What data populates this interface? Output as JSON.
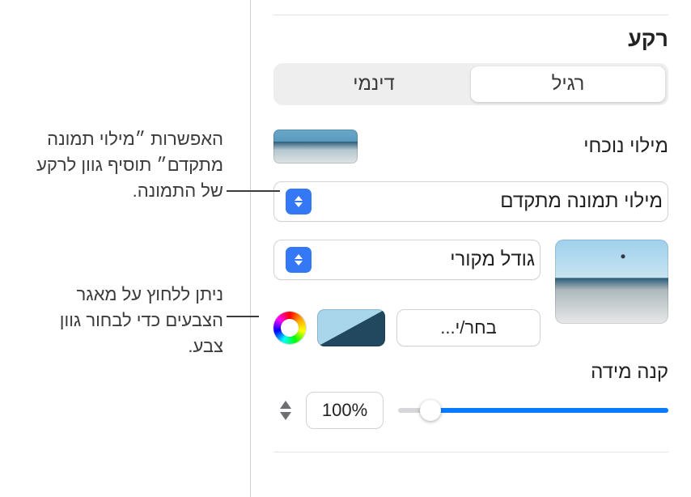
{
  "section_title": "רקע",
  "tabs": {
    "regular": "רגיל",
    "dynamic": "דינמי",
    "active": "regular"
  },
  "current_fill_label": "מילוי נוכחי",
  "fill_type_popup": "מילוי תמונה מתקדם",
  "size_popup": "גודל מקורי",
  "choose_button": "בחר/י...",
  "scale_label": "קנה מידה",
  "scale_value": "100%",
  "callouts": {
    "advanced_fill": "האפשרות ״מילוי תמונה מתקדם״ תוסיף גוון לרקע של התמונה.",
    "color_well": "ניתן ללחוץ על מאגר הצבעים כדי לבחור גוון צבע."
  }
}
